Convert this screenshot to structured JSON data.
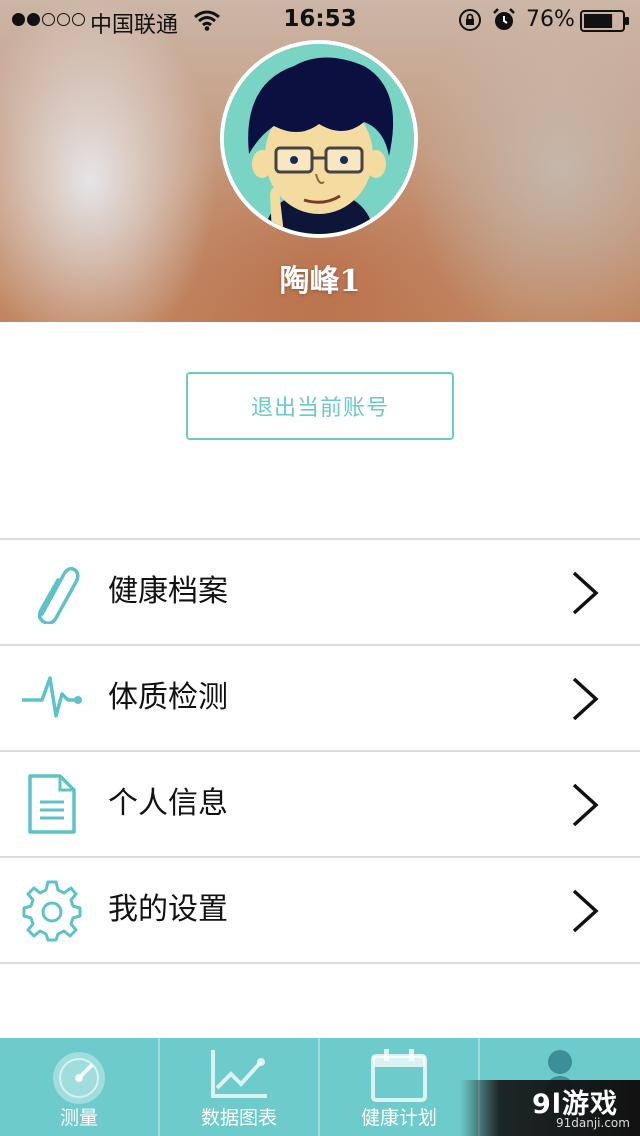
{
  "status_bar": {
    "carrier": "中国联通",
    "time": "16:53",
    "battery_percent": "76%",
    "battery_level": 0.76,
    "signal_bars_filled": 2,
    "signal_bars_total": 5
  },
  "profile": {
    "name": "陶峰1"
  },
  "logout_label": "退出当前账号",
  "menu": {
    "items": [
      {
        "label": "健康档案",
        "icon": "paperclip-icon"
      },
      {
        "label": "体质检测",
        "icon": "heartbeat-icon"
      },
      {
        "label": "个人信息",
        "icon": "document-icon"
      },
      {
        "label": "我的设置",
        "icon": "gear-icon"
      }
    ]
  },
  "tabbar": {
    "tabs": [
      {
        "label": "测量",
        "icon": "gauge-icon"
      },
      {
        "label": "数据图表",
        "icon": "line-chart-icon"
      },
      {
        "label": "健康计划",
        "icon": "calendar-icon"
      },
      {
        "label": "",
        "icon": "person-icon"
      }
    ]
  },
  "watermark": {
    "logo": "9l游戏",
    "url": "91danji.com"
  },
  "colors": {
    "accent": "#6cc9c9",
    "tabbar_bg": "#6ecbcb",
    "divider": "#dcdcdc"
  }
}
